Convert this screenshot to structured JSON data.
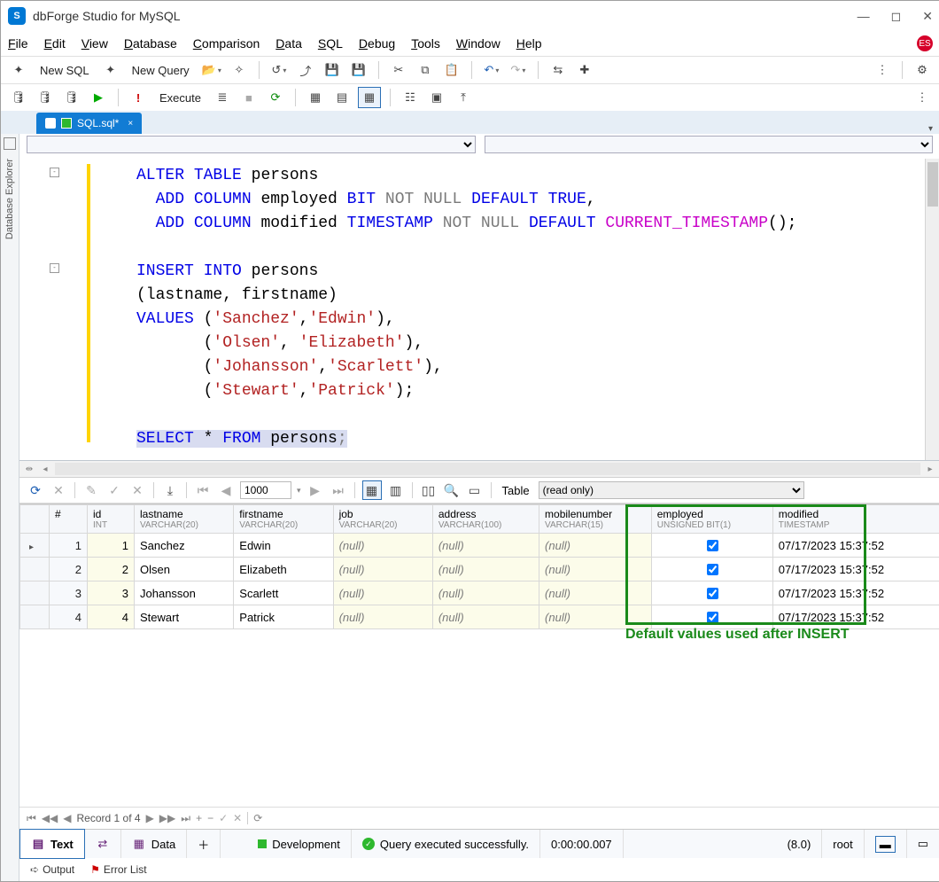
{
  "title": "dbForge Studio for MySQL",
  "menu": [
    "File",
    "Edit",
    "View",
    "Database",
    "Comparison",
    "Data",
    "SQL",
    "Debug",
    "Tools",
    "Window",
    "Help"
  ],
  "toolbar1": {
    "newSql": "New SQL",
    "newQuery": "New Query"
  },
  "toolbar2": {
    "execute": "Execute"
  },
  "tab": {
    "label": "SQL.sql*",
    "close": "×"
  },
  "sidebar": {
    "label": "Database Explorer"
  },
  "code": {
    "lines": [
      {
        "t": "stmt",
        "tokens": [
          [
            "kw",
            "ALTER"
          ],
          [
            "sp",
            " "
          ],
          [
            "kw",
            "TABLE"
          ],
          [
            "sp",
            " "
          ],
          [
            "id",
            "persons"
          ]
        ]
      },
      {
        "t": "cont",
        "tokens": [
          [
            "sp",
            "  "
          ],
          [
            "kw",
            "ADD"
          ],
          [
            "sp",
            " "
          ],
          [
            "kw",
            "COLUMN"
          ],
          [
            "sp",
            " "
          ],
          [
            "id",
            "employed "
          ],
          [
            "ty",
            "BIT"
          ],
          [
            "sp",
            " "
          ],
          [
            "gr",
            "NOT"
          ],
          [
            "sp",
            " "
          ],
          [
            "gr",
            "NULL"
          ],
          [
            "sp",
            " "
          ],
          [
            "kw",
            "DEFAULT"
          ],
          [
            "sp",
            " "
          ],
          [
            "kw",
            "TRUE"
          ],
          [
            "id",
            ","
          ]
        ]
      },
      {
        "t": "cont",
        "tokens": [
          [
            "sp",
            "  "
          ],
          [
            "kw",
            "ADD"
          ],
          [
            "sp",
            " "
          ],
          [
            "kw",
            "COLUMN"
          ],
          [
            "sp",
            " "
          ],
          [
            "id",
            "modified "
          ],
          [
            "ty",
            "TIMESTAMP"
          ],
          [
            "sp",
            " "
          ],
          [
            "gr",
            "NOT"
          ],
          [
            "sp",
            " "
          ],
          [
            "gr",
            "NULL"
          ],
          [
            "sp",
            " "
          ],
          [
            "kw",
            "DEFAULT"
          ],
          [
            "sp",
            " "
          ],
          [
            "fn",
            "CURRENT_TIMESTAMP"
          ],
          [
            "id",
            "();"
          ]
        ]
      },
      {
        "t": "blank"
      },
      {
        "t": "stmt",
        "tokens": [
          [
            "kw",
            "INSERT"
          ],
          [
            "sp",
            " "
          ],
          [
            "kw",
            "INTO"
          ],
          [
            "sp",
            " "
          ],
          [
            "id",
            "persons"
          ]
        ]
      },
      {
        "t": "cont",
        "tokens": [
          [
            "id",
            "(lastname, firstname)"
          ]
        ]
      },
      {
        "t": "cont",
        "tokens": [
          [
            "kw",
            "VALUES"
          ],
          [
            "sp",
            " "
          ],
          [
            "id",
            "("
          ],
          [
            "str",
            "'Sanchez'"
          ],
          [
            "id",
            ","
          ],
          [
            "str",
            "'Edwin'"
          ],
          [
            "id",
            "),"
          ]
        ]
      },
      {
        "t": "cont",
        "tokens": [
          [
            "sp",
            "       "
          ],
          [
            "id",
            "("
          ],
          [
            "str",
            "'Olsen'"
          ],
          [
            "id",
            ", "
          ],
          [
            "str",
            "'Elizabeth'"
          ],
          [
            "id",
            "),"
          ]
        ]
      },
      {
        "t": "cont",
        "tokens": [
          [
            "sp",
            "       "
          ],
          [
            "id",
            "("
          ],
          [
            "str",
            "'Johansson'"
          ],
          [
            "id",
            ","
          ],
          [
            "str",
            "'Scarlett'"
          ],
          [
            "id",
            "),"
          ]
        ]
      },
      {
        "t": "cont",
        "tokens": [
          [
            "sp",
            "       "
          ],
          [
            "id",
            "("
          ],
          [
            "str",
            "'Stewart'"
          ],
          [
            "id",
            ","
          ],
          [
            "str",
            "'Patrick'"
          ],
          [
            "id",
            ");"
          ]
        ]
      },
      {
        "t": "blank"
      },
      {
        "t": "sel",
        "tokens": [
          [
            "kw",
            "SELECT"
          ],
          [
            "sp",
            " "
          ],
          [
            "id",
            "* "
          ],
          [
            "kw",
            "FROM"
          ],
          [
            "sp",
            " "
          ],
          [
            "id",
            "persons"
          ],
          [
            "gr",
            ";"
          ]
        ]
      }
    ]
  },
  "resultToolbar": {
    "pageSize": "1000",
    "modeLabel": "Table",
    "modeValue": "(read only)"
  },
  "columns": [
    {
      "name": "#",
      "sub": ""
    },
    {
      "name": "id",
      "sub": "INT"
    },
    {
      "name": "lastname",
      "sub": "VARCHAR(20)"
    },
    {
      "name": "firstname",
      "sub": "VARCHAR(20)"
    },
    {
      "name": "job",
      "sub": "VARCHAR(20)"
    },
    {
      "name": "address",
      "sub": "VARCHAR(100)"
    },
    {
      "name": "mobilenumber",
      "sub": "VARCHAR(15)"
    },
    {
      "name": "employed",
      "sub": "UNSIGNED BIT(1)"
    },
    {
      "name": "modified",
      "sub": "TIMESTAMP"
    }
  ],
  "rows": [
    {
      "n": 1,
      "id": 1,
      "lastname": "Sanchez",
      "firstname": "Edwin",
      "job": "(null)",
      "address": "(null)",
      "mobilenumber": "(null)",
      "employed": true,
      "modified": "07/17/2023 15:37:52"
    },
    {
      "n": 2,
      "id": 2,
      "lastname": "Olsen",
      "firstname": "Elizabeth",
      "job": "(null)",
      "address": "(null)",
      "mobilenumber": "(null)",
      "employed": true,
      "modified": "07/17/2023 15:37:52"
    },
    {
      "n": 3,
      "id": 3,
      "lastname": "Johansson",
      "firstname": "Scarlett",
      "job": "(null)",
      "address": "(null)",
      "mobilenumber": "(null)",
      "employed": true,
      "modified": "07/17/2023 15:37:52"
    },
    {
      "n": 4,
      "id": 4,
      "lastname": "Stewart",
      "firstname": "Patrick",
      "job": "(null)",
      "address": "(null)",
      "mobilenumber": "(null)",
      "employed": true,
      "modified": "07/17/2023 15:37:52"
    }
  ],
  "callout": "Default values used after INSERT",
  "navigator": "Record 1 of 4",
  "status": {
    "text": "Text",
    "data": "Data",
    "env": "Development",
    "msg": "Query executed successfully.",
    "time": "0:00:00.007",
    "ver": "(8.0)",
    "user": "root"
  },
  "bottom": {
    "output": "Output",
    "errors": "Error List"
  }
}
